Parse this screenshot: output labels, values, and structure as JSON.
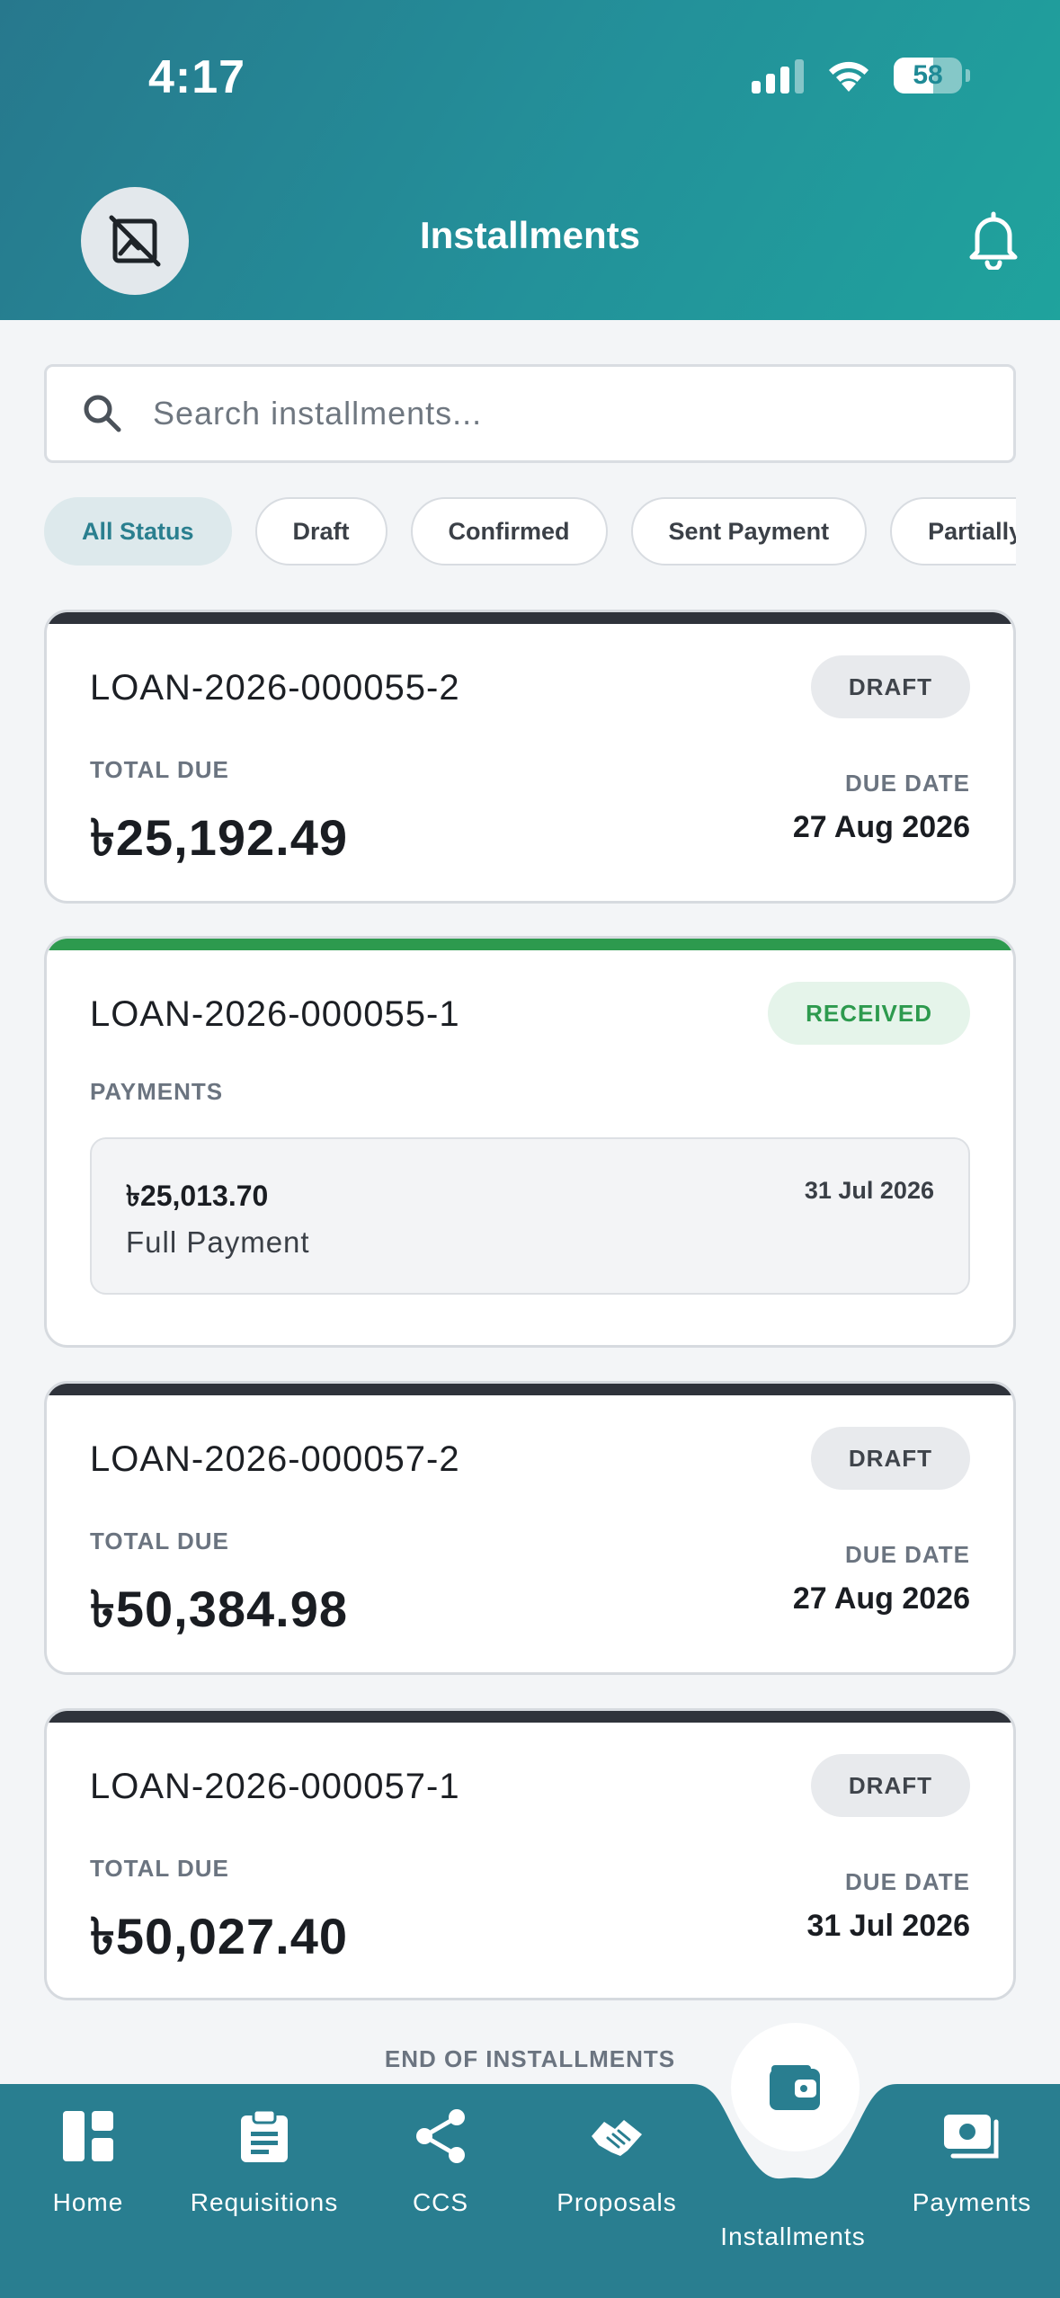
{
  "status_bar": {
    "time": "4:17",
    "battery": "58"
  },
  "header": {
    "title": "Installments"
  },
  "search": {
    "placeholder": "Search installments..."
  },
  "filters": [
    "All Status",
    "Draft",
    "Confirmed",
    "Sent Payment",
    "Partially Paid"
  ],
  "labels": {
    "total_due": "TOTAL DUE",
    "due_date": "DUE DATE",
    "payments": "PAYMENTS",
    "end": "END OF INSTALLMENTS"
  },
  "cards": [
    {
      "id": "LOAN-2026-000055-2",
      "status": "DRAFT",
      "total_due": "৳25,192.49",
      "due_date": "27 Aug 2026"
    },
    {
      "id": "LOAN-2026-000055-1",
      "status": "RECEIVED",
      "payment": {
        "amount": "৳25,013.70",
        "date": "31 Jul 2026",
        "type": "Full Payment"
      }
    },
    {
      "id": "LOAN-2026-000057-2",
      "status": "DRAFT",
      "total_due": "৳50,384.98",
      "due_date": "27 Aug 2026"
    },
    {
      "id": "LOAN-2026-000057-1",
      "status": "DRAFT",
      "total_due": "৳50,027.40",
      "due_date": "31 Jul 2026"
    }
  ],
  "nav": {
    "items": [
      "Home",
      "Requisitions",
      "CCS",
      "Proposals",
      "Installments",
      "Payments"
    ],
    "active": "Installments"
  },
  "colors": {
    "header_start": "#27788d",
    "header_end": "#1fa39d",
    "nav_bg": "#297e90",
    "draft_bar": "#2f333b",
    "received_green": "#2d9a4e"
  }
}
